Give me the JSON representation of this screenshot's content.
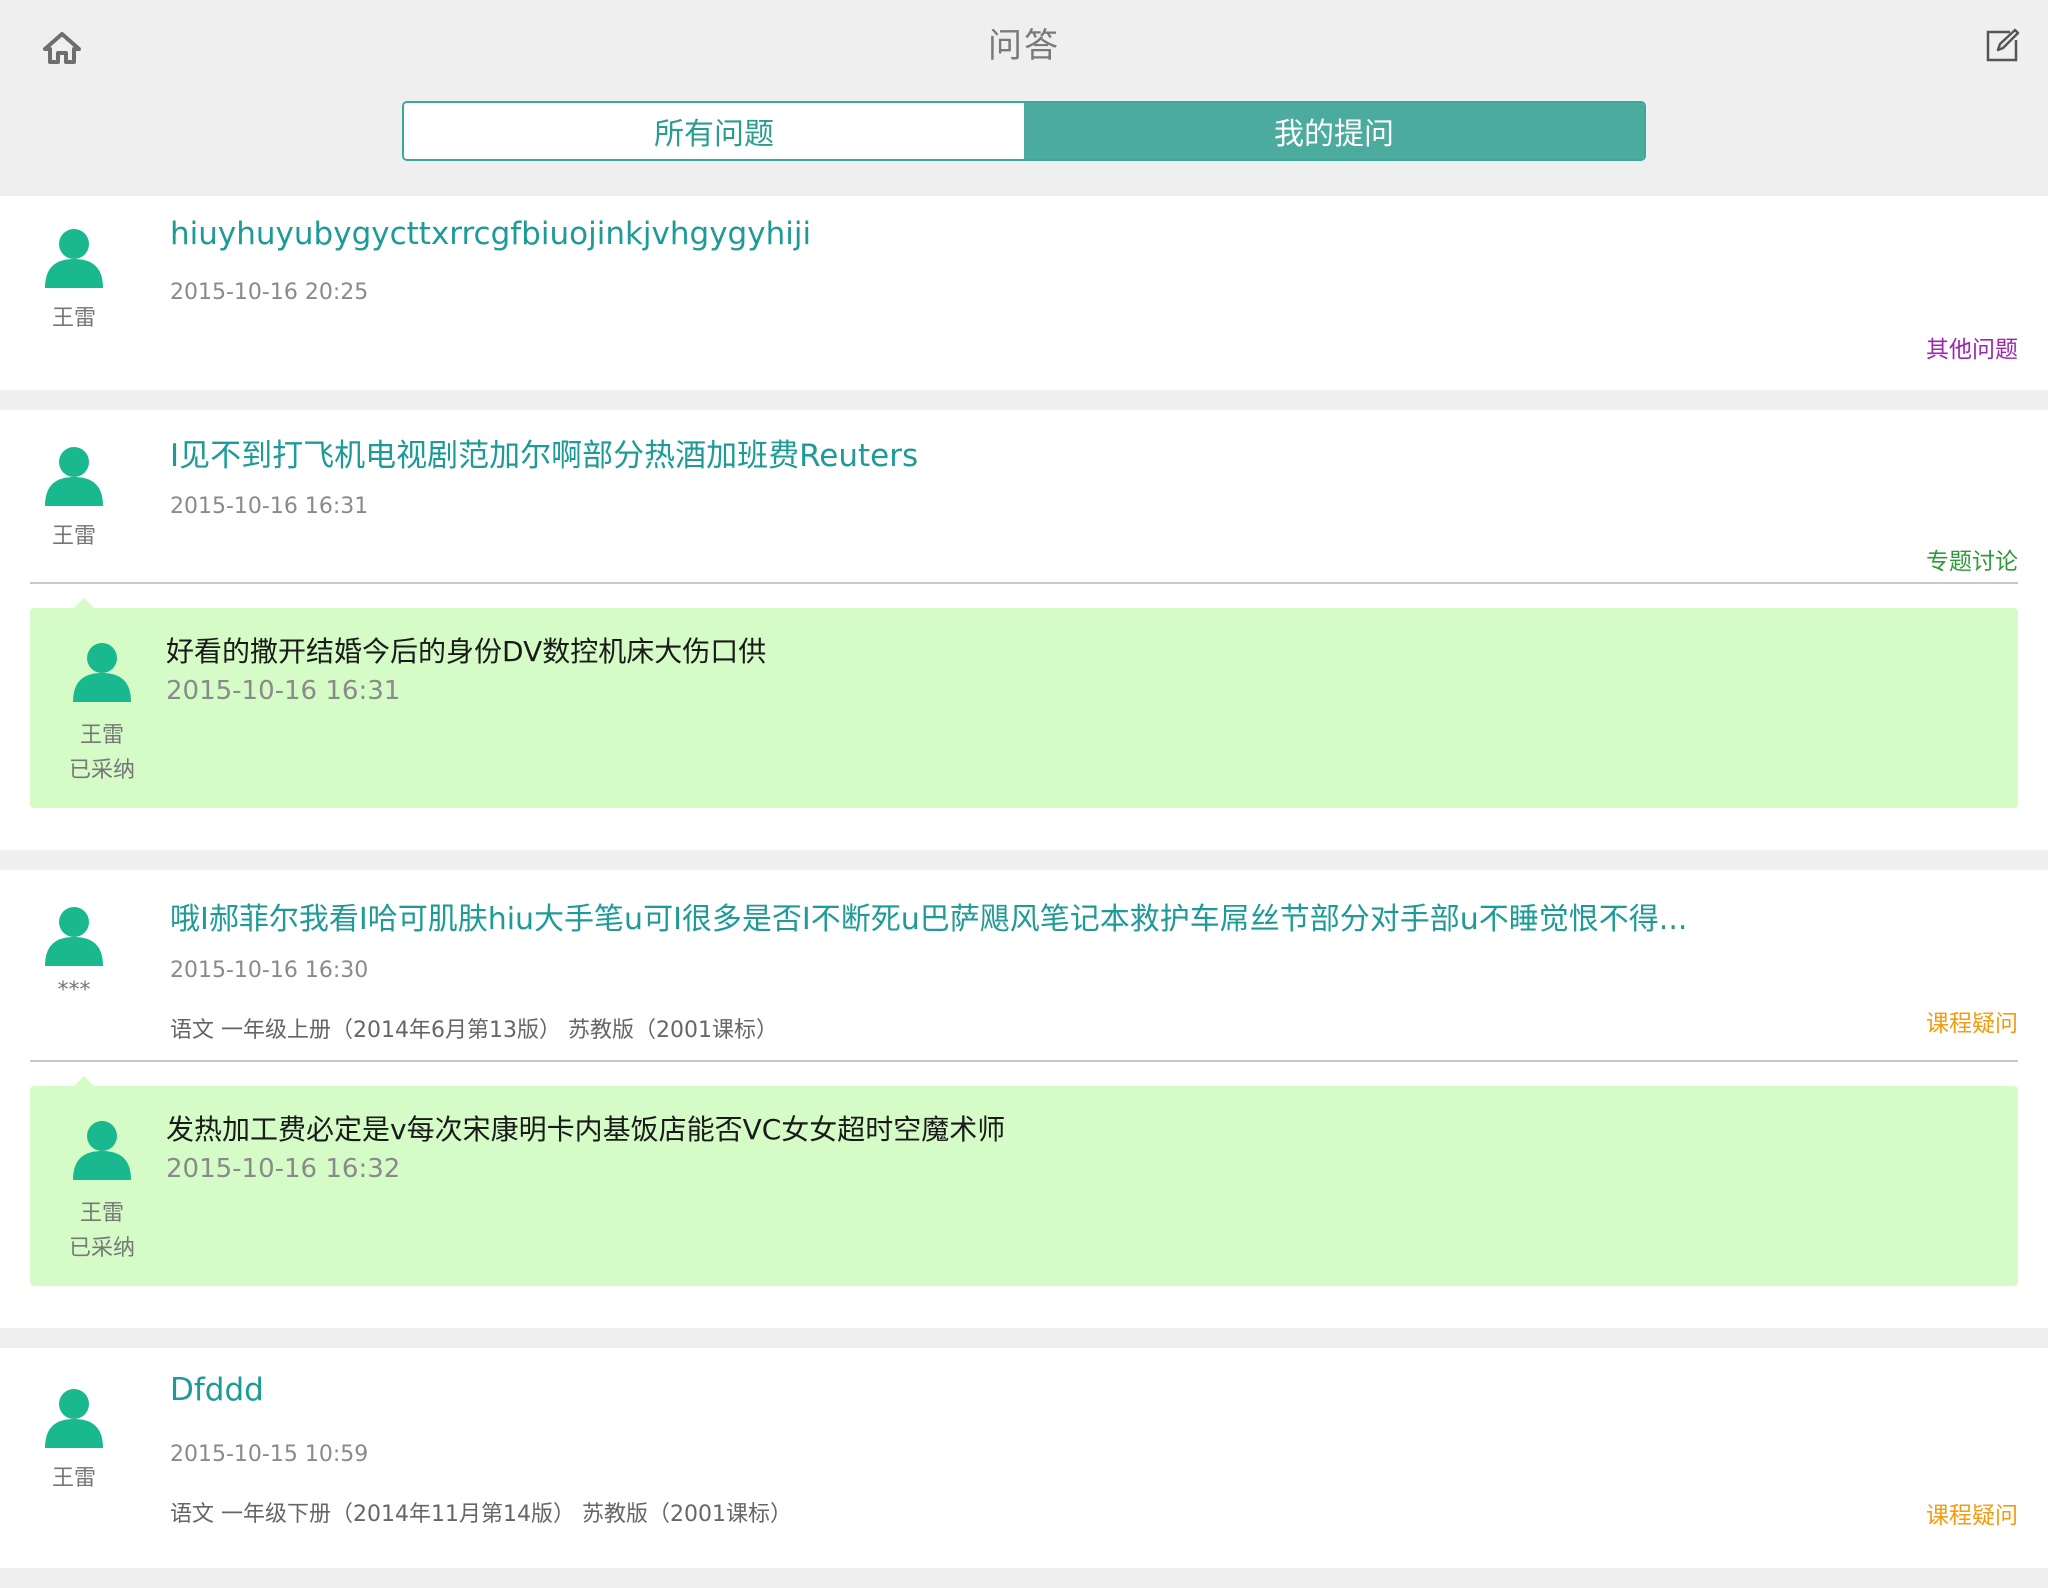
{
  "header": {
    "title": "问答",
    "home_icon": "home-icon",
    "compose_icon": "compose-icon",
    "tabs": [
      {
        "label": "所有问题",
        "active": false
      },
      {
        "label": "我的提问",
        "active": true
      }
    ]
  },
  "colors": {
    "accent": "#4aab9e",
    "title_teal": "#1e9b96",
    "answer_bg": "#d5fcc7",
    "avatar_green": "#1ab88e",
    "cat_purple": "#9b27b0",
    "cat_green": "#2e9a3a",
    "cat_orange": "#f39c12"
  },
  "questions": [
    {
      "author": "王雷",
      "title": "hiuyhuyubygycttxrrcgfbiuojinkjvhgygyhiji",
      "time": "2015-10-16 20:25",
      "course": "",
      "category": "其他问题",
      "category_color": "#9b27b0"
    },
    {
      "author": "王雷",
      "title": "I见不到打飞机电视剧范加尔啊部分热酒加班费Reuters",
      "time": "2015-10-16 16:31",
      "course": "",
      "category": "专题讨论",
      "category_color": "#2e9a3a",
      "answer": {
        "author": "王雷",
        "status": "已采纳",
        "text": "好看的撒开结婚今后的身份DV数控机床大伤口供",
        "time": "2015-10-16 16:31"
      }
    },
    {
      "author": "***",
      "title": "哦I郝菲尔我看I哈可肌肤hiu大手笔u可I很多是否I不断死u巴萨飓风笔记本救护车屌丝节部分对手部u不睡觉恨不得...",
      "time": "2015-10-16 16:30",
      "course": "语文  一年级上册（2014年6月第13版） 苏教版（2001课标）",
      "category": "课程疑问",
      "category_color": "#f39c12",
      "answer": {
        "author": "王雷",
        "status": "已采纳",
        "text": "发热加工费必定是v每次宋康明卡内基饭店能否VC女女超时空魔术师",
        "time": "2015-10-16 16:32"
      }
    },
    {
      "author": "王雷",
      "title": "Dfddd",
      "time": "2015-10-15 10:59",
      "course": "语文  一年级下册（2014年11月第14版） 苏教版（2001课标）",
      "category": "课程疑问",
      "category_color": "#f39c12"
    }
  ]
}
